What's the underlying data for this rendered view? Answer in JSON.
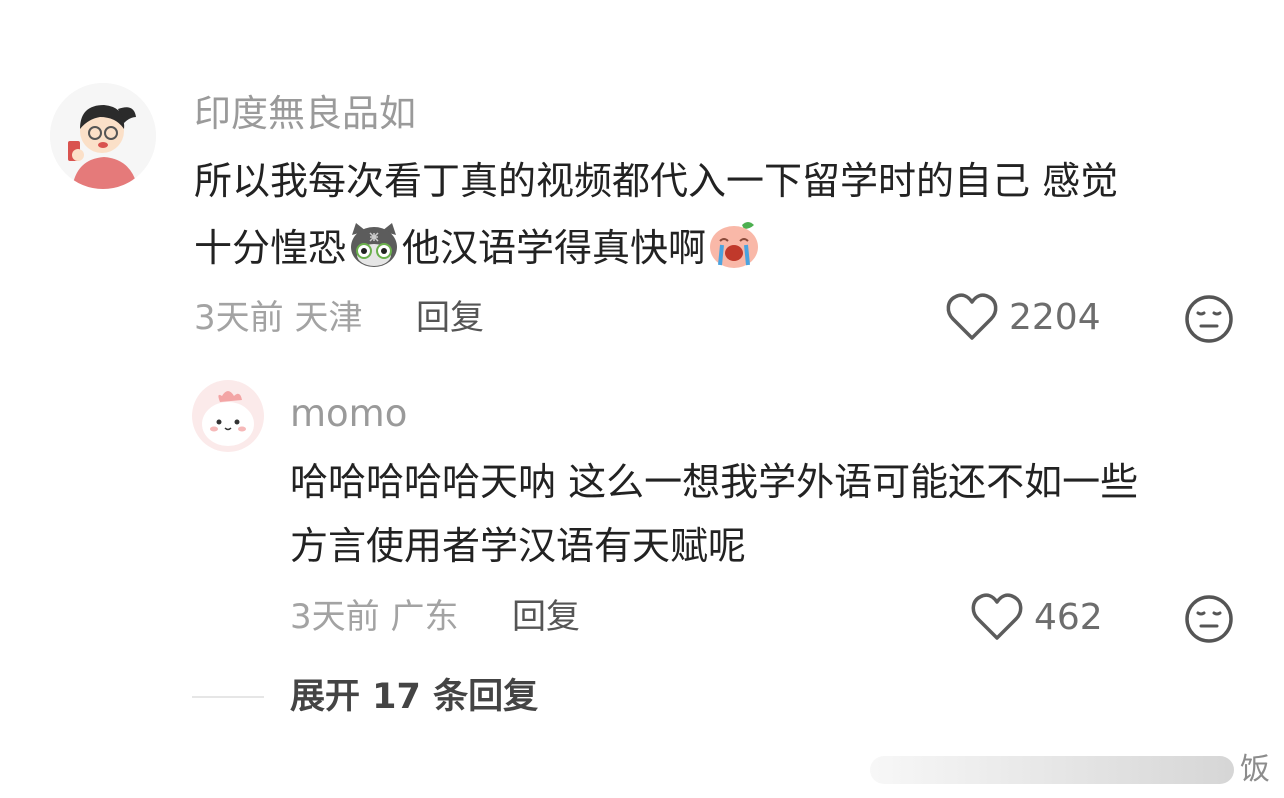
{
  "comments": [
    {
      "username": "印度無良品如",
      "text_line1": "所以我每次看丁真的视频都代入一下留学时的自己 感觉",
      "text_line2_a": "十分惶恐",
      "text_line2_b": "他汉语学得真快啊",
      "time": "3天前",
      "location": "天津",
      "reply_label": "回复",
      "likes": "2204"
    },
    {
      "username": "momo",
      "text_line1": "哈哈哈哈哈天呐 这么一想我学外语可能还不如一些",
      "text_line2": "方言使用者学汉语有天赋呢",
      "time": "3天前",
      "location": "广东",
      "reply_label": "回复",
      "likes": "462"
    }
  ],
  "expand_label": "展开 17 条回复",
  "watermark_char": "饭",
  "icons": {
    "like": "heart-outline-icon",
    "reaction": "neutral-face-icon",
    "emoji_1": "cat-face-emoji",
    "emoji_2": "crying-face-emoji"
  },
  "colors": {
    "username": "#9a9a9a",
    "body_text": "#222222",
    "meta_text": "#a3a3a3"
  }
}
